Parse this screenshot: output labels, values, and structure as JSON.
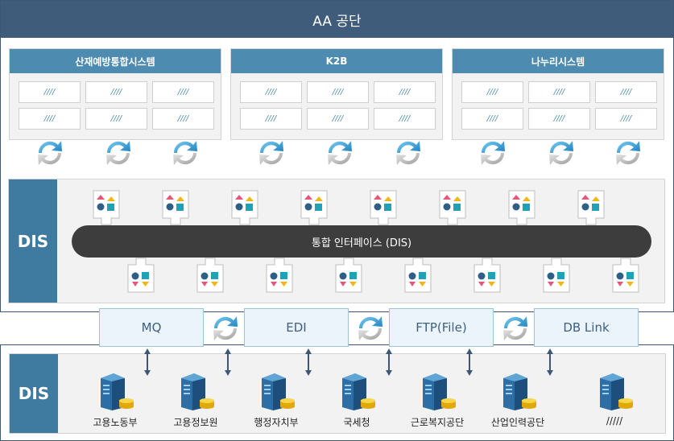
{
  "org": {
    "title": "AA 공단"
  },
  "systems": [
    {
      "name": "산재예방통합시스템",
      "cells": [
        "////",
        "////",
        "////",
        "////",
        "////",
        "////"
      ]
    },
    {
      "name": "K2B",
      "cells": [
        "////",
        "////",
        "////",
        "////",
        "////",
        "////"
      ]
    },
    {
      "name": "나누리시스템",
      "cells": [
        "////",
        "////",
        "////",
        "////",
        "////",
        "////"
      ]
    }
  ],
  "dis_label": "DIS",
  "bus_label": "통합 인터페이스 (DIS)",
  "protocols": [
    "MQ",
    "EDI",
    "FTP(File)",
    "DB Link"
  ],
  "bottom_label": "DIS",
  "agencies": [
    "고용노동부",
    "고용정보원",
    "행정자치부",
    "국세청",
    "근로복지공단",
    "산업인력공단",
    "/////"
  ],
  "colors": {
    "header": "#3f5c7a",
    "system_head": "#4d8cb0",
    "dis_label": "#3f7aa0",
    "bus": "#3d3d3d"
  }
}
